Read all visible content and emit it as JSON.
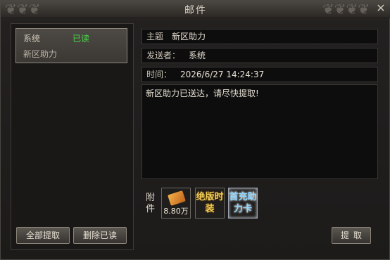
{
  "window": {
    "title": "邮件",
    "close_glyph": "✕"
  },
  "mail_list": [
    {
      "sender": "系统",
      "status": "已读",
      "subject": "新区助力"
    }
  ],
  "left_buttons": {
    "claim_all": "全部提取",
    "delete_read": "删除已读"
  },
  "detail": {
    "subject_label": "主题",
    "subject": "新区助力",
    "sender_label": "发送者：",
    "sender": "系统",
    "time_label": "时间：",
    "time": "2026/6/27 14:24:37",
    "body": "新区助力已送达，请尽快提取!"
  },
  "attachments": {
    "label": "附件",
    "items": [
      {
        "name": "gold-ingot-icon",
        "amount": "8.80万"
      },
      {
        "text": "绝版时装"
      },
      {
        "text": "首充助力卡"
      }
    ]
  },
  "claim_button": "提取",
  "colors": {
    "status_read": "#48d848",
    "accent_gold": "#f3d15a"
  }
}
